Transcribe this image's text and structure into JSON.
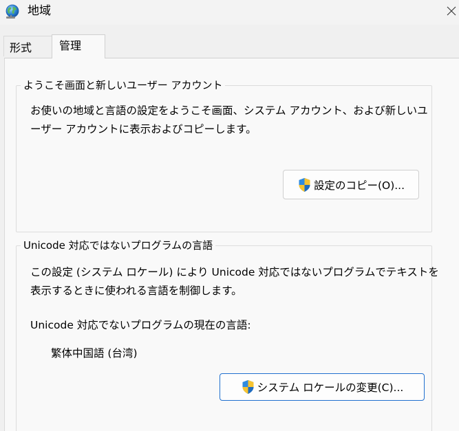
{
  "window": {
    "title": "地域",
    "icon": "globe-icon",
    "close_icon": "close-icon"
  },
  "tabs": [
    {
      "label": "形式",
      "selected": false
    },
    {
      "label": "管理",
      "selected": true
    }
  ],
  "welcome_section": {
    "legend": "ようこそ画面と新しいユーザー アカウント",
    "description_line1": "お使いの地域と言語の設定をようこそ画面、システム アカウント、および新しいユ",
    "description_line2": "ーザー アカウントに表示およびコピーします。",
    "copy_button_label": "設定のコピー(O)...",
    "copy_button_icon": "uac-shield-icon"
  },
  "unicode_section": {
    "legend": "Unicode 対応ではないプログラムの言語",
    "description_line1": "この設定 (システム ロケール) により Unicode 対応ではないプログラムでテキストを",
    "description_line2": "表示するときに使われる言語を制御します。",
    "current_label": "Unicode 対応でないプログラムの現在の言語:",
    "current_value": "繁体中国語 (台湾)",
    "change_button_label": "システム ロケールの変更(C)...",
    "change_button_icon": "uac-shield-icon"
  },
  "colors": {
    "accent": "#1f6fcf",
    "background": "#f0f0f0",
    "panel": "#f9f9f9"
  }
}
